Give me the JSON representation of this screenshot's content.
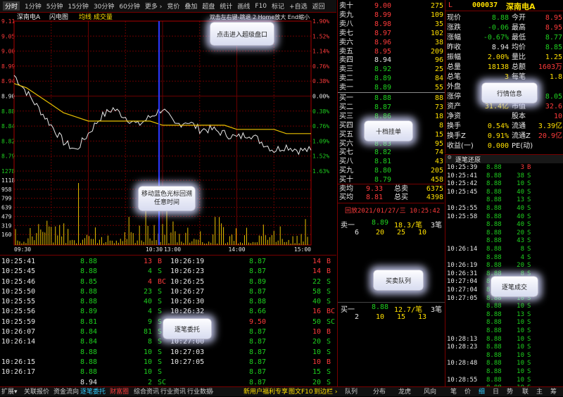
{
  "toolbar": {
    "items": [
      "分时",
      "1分钟",
      "5分钟",
      "15分钟",
      "30分钟",
      "60分钟",
      "更多 ›",
      "竞价",
      "叠加",
      "超盘",
      "统计",
      "画线",
      "F10",
      "标记",
      "+自选",
      "返回"
    ]
  },
  "chart": {
    "title": "深南电A",
    "mode": "闪电图",
    "legend": "均线 成交量",
    "hint": "双击左右键-跳退 2 Home放大 End缩小",
    "price_ticks": [
      "9.11",
      "9.05",
      "9.00",
      "8.99",
      "8.94",
      "8.90",
      "8.88",
      "8.84",
      "8.82",
      "8.79",
      "1278"
    ],
    "pct_ticks": [
      "1.90%",
      "1.52%",
      "1.14%",
      "0.76%",
      "0.38%",
      "0.00%",
      "0.38%",
      "0.76%",
      "1.09%",
      "1.52%",
      "1.63%"
    ],
    "vol_ticks": [
      "1118",
      "958",
      "799",
      "639",
      "479",
      "319",
      "160"
    ],
    "time_ticks": [
      "09:30",
      "10:30",
      "13:00",
      "14:00",
      "15:00"
    ],
    "time_hint": "移动蓝色光标回溯任意时间"
  },
  "chart_data": {
    "type": "line",
    "x": [
      "09:30",
      "09:40",
      "09:50",
      "10:00",
      "10:10",
      "10:20",
      "10:30",
      "10:40",
      "10:50",
      "11:00",
      "11:10",
      "11:20",
      "11:30",
      "13:10",
      "13:20",
      "13:30",
      "13:40",
      "13:50",
      "14:00",
      "14:10",
      "14:20",
      "14:30",
      "14:40",
      "14:50",
      "15:00"
    ],
    "series": [
      {
        "values": [
          8.98,
          8.94,
          8.9,
          8.86,
          8.82,
          8.8,
          8.84,
          8.88,
          8.9,
          8.88,
          8.86,
          8.88,
          8.9,
          8.86,
          8.87,
          8.85,
          8.85,
          8.84,
          8.83,
          8.84,
          8.82,
          8.8,
          8.81,
          8.8,
          8.8
        ]
      },
      {
        "values": [
          8.96,
          8.95,
          8.93,
          8.91,
          8.89,
          8.88,
          8.87,
          8.87,
          8.87,
          8.87,
          8.87,
          8.87,
          8.86,
          8.86,
          8.86,
          8.86,
          8.86,
          8.86,
          8.85,
          8.85,
          8.85,
          8.85,
          8.84,
          8.84,
          8.84
        ]
      }
    ],
    "ylim": [
      8.75,
      9.11
    ]
  },
  "ticks": {
    "left": [
      [
        "10:25:41",
        "8.88",
        "13",
        "B"
      ],
      [
        "10:25:45",
        "8.88",
        "4",
        "S"
      ],
      [
        "10:25:46",
        "8.85",
        "4",
        "BC"
      ],
      [
        "10:25:50",
        "8.88",
        "23",
        "S"
      ],
      [
        "10:25:55",
        "8.88",
        "40",
        "S"
      ],
      [
        "10:25:56",
        "8.89",
        "4",
        "S"
      ],
      [
        "10:25:59",
        "8.81",
        "9",
        "S"
      ],
      [
        "10:26:07",
        "8.84",
        "81",
        "S"
      ],
      [
        "10:26:14",
        "8.84",
        "8",
        "S"
      ],
      [
        "",
        "8.88",
        "10",
        "S"
      ],
      [
        "10:26:15",
        "8.88",
        "10",
        "S"
      ],
      [
        "10:26:17",
        "8.88",
        "10",
        "S"
      ],
      [
        "",
        "8.94",
        "2",
        "SC"
      ]
    ],
    "right": [
      [
        "10:26:19",
        "8.87",
        "14",
        "B"
      ],
      [
        "10:26:23",
        "8.87",
        "14",
        "B"
      ],
      [
        "10:26:25",
        "8.89",
        "22",
        "S"
      ],
      [
        "10:26:27",
        "8.87",
        "58",
        "S"
      ],
      [
        "10:26:30",
        "8.88",
        "40",
        "S"
      ],
      [
        "10:26:32",
        "8.66",
        "16",
        "BC"
      ],
      [
        "10:26:34",
        "9.50",
        "50",
        "SC"
      ],
      [
        "10:26:37",
        "8.87",
        "10",
        "B"
      ],
      [
        "10:27:00",
        "8.87",
        "20",
        "S"
      ],
      [
        "10:27:03",
        "8.87",
        "10",
        "S"
      ],
      [
        "10:27:05",
        "8.87",
        "10",
        "B"
      ],
      [
        "",
        "8.87",
        "15",
        "S"
      ],
      [
        "",
        "8.87",
        "20",
        "S"
      ]
    ]
  },
  "ticks_hint": "逐笔委托",
  "book": {
    "sell": [
      [
        "卖十",
        "9.00",
        "275"
      ],
      [
        "卖九",
        "8.99",
        "109"
      ],
      [
        "卖八",
        "8.98",
        "35"
      ],
      [
        "卖七",
        "8.97",
        "102"
      ],
      [
        "卖六",
        "8.96",
        "38"
      ],
      [
        "卖五",
        "8.95",
        "209"
      ],
      [
        "卖四",
        "8.94",
        "96"
      ],
      [
        "卖三",
        "8.92",
        "25"
      ],
      [
        "卖二",
        "8.89",
        "84"
      ],
      [
        "卖一",
        "8.89",
        "55"
      ]
    ],
    "buy": [
      [
        "买一",
        "8.88",
        "88"
      ],
      [
        "买二",
        "8.87",
        "73"
      ],
      [
        "买三",
        "8.86",
        "18"
      ],
      [
        "买四",
        "8.85",
        "8"
      ],
      [
        "买五",
        "8.84",
        "15"
      ],
      [
        "买六",
        "8.83",
        "95"
      ],
      [
        "买七",
        "8.82",
        "74"
      ],
      [
        "买八",
        "8.81",
        "43"
      ],
      [
        "买九",
        "8.80",
        "205"
      ],
      [
        "买十",
        "8.79",
        "458"
      ]
    ],
    "avg_sell": [
      "卖均",
      "9.33",
      "总卖",
      "6375"
    ],
    "avg_buy": [
      "买均",
      "8.81",
      "总买",
      "4398"
    ],
    "hint": "十档挂单"
  },
  "queue": {
    "header": "回放2021/01/27/三 10:25:42",
    "sell": [
      "卖一",
      "8.89",
      "18.3/笔",
      "3笔"
    ],
    "sell_vol": [
      "6",
      "20",
      "25",
      "10"
    ],
    "buy": [
      "买一",
      "8.88",
      "12.7/笔",
      "3笔"
    ],
    "buy_vol": [
      "2",
      "10",
      "15",
      "13"
    ],
    "hint": "买卖队列"
  },
  "info": {
    "code": "000037",
    "name": "深南电A",
    "mark": "L",
    "rows": [
      [
        "现价",
        "8.88",
        "今开",
        "8.95"
      ],
      [
        "涨跌",
        "-0.06",
        "最高",
        "8.95"
      ],
      [
        "涨幅",
        "-0.67%",
        "最低",
        "8.77"
      ],
      [
        "昨收",
        "8.94",
        "均价",
        "8.85"
      ],
      [
        "振幅",
        "2.00%",
        "量比",
        "1.25"
      ],
      [
        "总量",
        "18138",
        "总额",
        "1603万"
      ],
      [
        "总笔",
        "3",
        "每笔",
        "1.8"
      ],
      [
        "外盘",
        "",
        "",
        ""
      ],
      [
        "涨停",
        "",
        "",
        "8.05"
      ],
      [
        "资产",
        "31.4亿",
        "市值",
        "32.6"
      ],
      [
        "净资",
        "",
        "股本",
        "10"
      ],
      [
        "换手",
        "0.54%",
        "流通",
        "3.39亿"
      ],
      [
        "换手Z",
        "0.91%",
        "流通Z",
        "20.9亿"
      ],
      [
        "收益(一)",
        "0.000",
        "PE(动)",
        ""
      ]
    ],
    "hint": "行情信息"
  },
  "deal": {
    "header": "逐笔还原",
    "rows": [
      [
        "10:25:39",
        "8.88",
        "3",
        "B"
      ],
      [
        "10:25:41",
        "8.88",
        "38",
        "S"
      ],
      [
        "10:25:42",
        "8.88",
        "10",
        "S"
      ],
      [
        "10:25:45",
        "8.88",
        "40",
        "S"
      ],
      [
        "",
        "8.88",
        "13",
        "S"
      ],
      [
        "10:25:55",
        "8.88",
        "40",
        "S"
      ],
      [
        "10:25:58",
        "8.88",
        "40",
        "S"
      ],
      [
        "",
        "8.88",
        "40",
        "S"
      ],
      [
        "",
        "8.88",
        "20",
        "S"
      ],
      [
        "",
        "8.88",
        "43",
        "S"
      ],
      [
        "10:26:14",
        "8.88",
        "8",
        "S"
      ],
      [
        "",
        "8.88",
        "4",
        "S"
      ],
      [
        "10:26:19",
        "8.88",
        "20",
        "S"
      ],
      [
        "10:26:31",
        "8.88",
        "8",
        "S"
      ],
      [
        "10:27:04",
        "8.88",
        "15",
        "S"
      ],
      [
        "10:27:04",
        "8.88",
        "10",
        "S"
      ],
      [
        "10:27:05",
        "8.88",
        "10",
        "S"
      ],
      [
        "",
        "8.88",
        "10",
        "S"
      ],
      [
        "",
        "8.88",
        "13",
        "S"
      ],
      [
        "",
        "8.88",
        "10",
        "S"
      ],
      [
        "",
        "8.88",
        "10",
        "S"
      ],
      [
        "10:28:13",
        "8.88",
        "10",
        "S"
      ],
      [
        "10:28:23",
        "8.88",
        "10",
        "S"
      ],
      [
        "",
        "8.88",
        "10",
        "S"
      ],
      [
        "10:28:48",
        "8.88",
        "10",
        "S"
      ],
      [
        "",
        "8.88",
        "10",
        "S"
      ],
      [
        "10:28:55",
        "8.88",
        "10",
        "S"
      ],
      [
        "",
        "8.88",
        "10",
        "S"
      ]
    ],
    "hint": "逐笔成交"
  },
  "bottom_left": [
    "扩展▾",
    "关联报价",
    "资金流向",
    "逐笔委托",
    "财富圈",
    "综合资讯",
    "行业资讯",
    "行业数据",
    "›"
  ],
  "bottom_mid": [
    "新用户福利专享",
    "图文F10",
    "到边栏 ›"
  ],
  "bottom_right": [
    "队列",
    "分布",
    "龙虎",
    "风向",
    "笔",
    "价",
    "细",
    "日",
    "势",
    "联",
    "主",
    "筹"
  ],
  "super_hint": "点击进入超级盘口"
}
